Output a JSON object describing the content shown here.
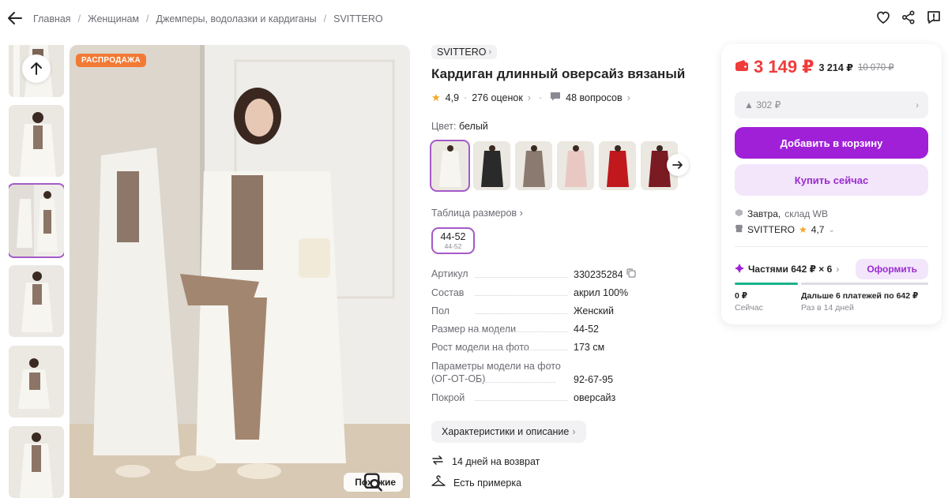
{
  "breadcrumb": [
    "Главная",
    "Женщинам",
    "Джемперы, водолазки и кардиганы",
    "SVITTERO"
  ],
  "header_icons": [
    "heart-icon",
    "share-icon",
    "report-icon"
  ],
  "gallery": {
    "sale_badge": "РАСПРОДАЖА",
    "similar_label": "Похожие",
    "thumb_count": 6,
    "active_thumb": 3
  },
  "product": {
    "brand": "SVITTERO",
    "title": "Кардиган длинный оверсайз вязаный",
    "rating": "4,9",
    "reviews": "276 оценок",
    "questions": "48 вопросов",
    "color_label": "Цвет:",
    "color_value": "белый",
    "size_table_label": "Таблица размеров",
    "size_main": "44-52",
    "size_sub": "44-52",
    "specs": [
      {
        "k": "Артикул",
        "v": "330235284"
      },
      {
        "k": "Состав",
        "v": "акрил 100%"
      },
      {
        "k": "Пол",
        "v": "Женский"
      },
      {
        "k": "Размер на модели",
        "v": "44-52"
      },
      {
        "k": "Рост модели на фото",
        "v": "173 см"
      },
      {
        "k": "Параметры модели на фото (ОГ-ОТ-ОБ)",
        "v": "92-67-95"
      },
      {
        "k": "Покрой",
        "v": "оверсайз"
      }
    ],
    "description_button": "Характеристики и описание",
    "perks": [
      "14 дней на возврат",
      "Есть примерка"
    ]
  },
  "swatch_colors": [
    "#ece9e2",
    "#2a2a2a",
    "#8a7a70",
    "#e9c8c4",
    "#c0181d",
    "#7a1a22"
  ],
  "buy": {
    "price": "3 149 ₽",
    "wallet_price": "3 214 ₽",
    "old_price": "10 070 ₽",
    "delta": "▲ 302 ₽",
    "add_to_cart": "Добавить в корзину",
    "buy_now": "Купить сейчас",
    "delivery_day": "Завтра,",
    "delivery_where": "склад WB",
    "seller_name": "SVITTERO",
    "seller_rating": "4,7",
    "split_label": "Частями 642 ₽ × 6",
    "split_button": "Оформить",
    "now_amount": "0 ₽",
    "now_label": "Сейчас",
    "later_amount": "Дальше 6 платежей по 642 ₽",
    "later_label": "Раз в 14 дней"
  },
  "colors": {
    "accent": "#a020d8",
    "price_red": "#f03b3b",
    "sale_orange": "#f27a35",
    "progress_green": "#1bb28b"
  }
}
